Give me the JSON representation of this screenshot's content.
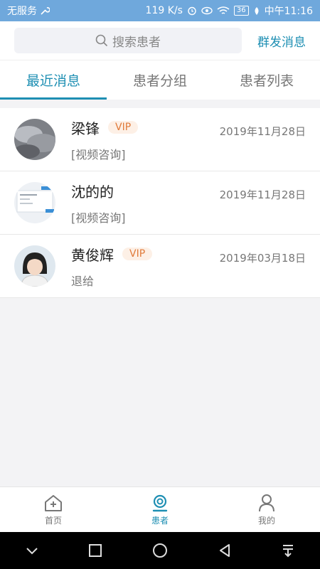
{
  "status_bar": {
    "carrier": "无服务",
    "speed": "119 K/s",
    "battery": "36",
    "time": "中午11:16"
  },
  "header": {
    "search_placeholder": "搜索患者",
    "broadcast_label": "群发消息"
  },
  "tabs": [
    {
      "label": "最近消息",
      "active": true
    },
    {
      "label": "患者分组",
      "active": false
    },
    {
      "label": "患者列表",
      "active": false
    }
  ],
  "messages": [
    {
      "name": "梁锋",
      "vip": "VIP",
      "preview": "[视频咨询]",
      "date": "2019年11月28日"
    },
    {
      "name": "沈的的",
      "preview": "[视频咨询]",
      "date": "2019年11月28日"
    },
    {
      "name": "黄俊辉",
      "vip": "VIP",
      "preview": "退给",
      "date": "2019年03月18日"
    }
  ],
  "bottom_tabs": [
    {
      "label": "首页",
      "icon": "home-icon",
      "active": false
    },
    {
      "label": "患者",
      "icon": "patient-icon",
      "active": true
    },
    {
      "label": "我的",
      "icon": "profile-icon",
      "active": false
    }
  ],
  "colors": {
    "accent": "#1e8fb3",
    "status_bar": "#6fa8dc",
    "vip_text": "#e07a3a"
  }
}
